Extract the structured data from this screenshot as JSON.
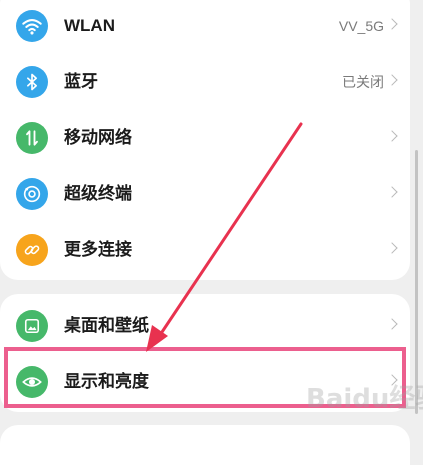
{
  "settings": {
    "network_items": [
      {
        "label": "WLAN",
        "value": "VV_5G",
        "icon": "wifi-icon",
        "color": "#34a6ea"
      },
      {
        "label": "蓝牙",
        "value": "已关闭",
        "icon": "bluetooth-icon",
        "color": "#34a6ea"
      },
      {
        "label": "移动网络",
        "value": "",
        "icon": "mobile-network-icon",
        "color": "#46b86a"
      },
      {
        "label": "超级终端",
        "value": "",
        "icon": "super-device-icon",
        "color": "#34a6ea"
      },
      {
        "label": "更多连接",
        "value": "",
        "icon": "link-icon",
        "color": "#f7a41c"
      }
    ],
    "display_items": [
      {
        "label": "桌面和壁纸",
        "value": "",
        "icon": "wallpaper-icon",
        "color": "#46b86a"
      },
      {
        "label": "显示和亮度",
        "value": "",
        "icon": "eye-icon",
        "color": "#46b86a"
      }
    ]
  },
  "annotation": {
    "highlight_color": "#ec5f8e",
    "arrow_color": "#e8324f",
    "watermark": "Baidu经验"
  }
}
